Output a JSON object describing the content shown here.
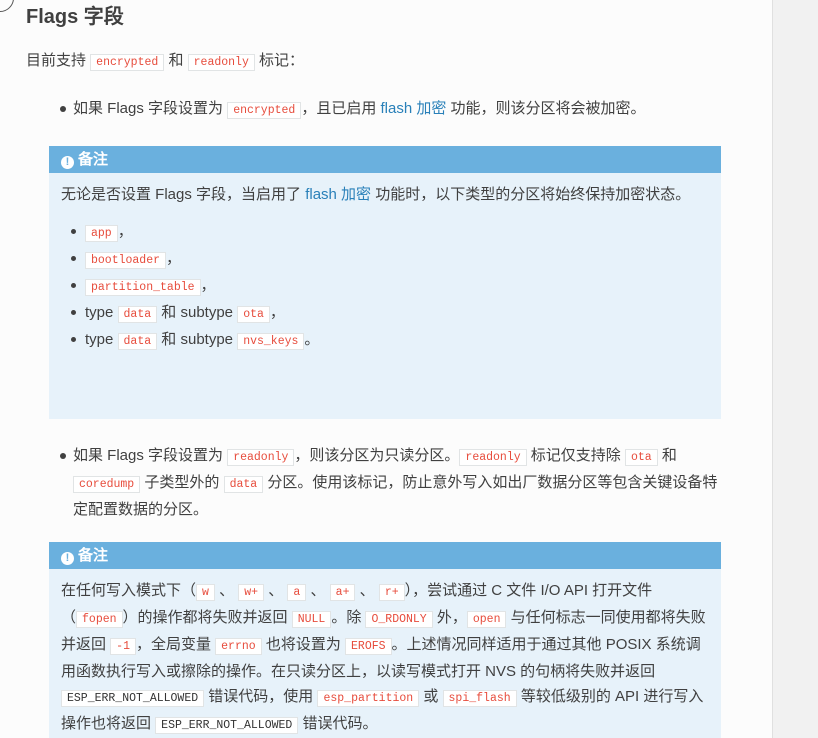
{
  "heading": "Flags 字段",
  "intro": {
    "pre": "目前支持 ",
    "code1": "encrypted",
    "mid": " 和 ",
    "code2": "readonly",
    "post": " 标记："
  },
  "item1": {
    "pre": "如果 Flags 字段设置为 ",
    "code": "encrypted",
    "mid": "，且已启用 ",
    "link": "flash 加密",
    "post": " 功能，则该分区将会被加密。"
  },
  "note1": {
    "title": "备注",
    "text_pre": "无论是否设置 Flags 字段，当启用了 ",
    "link": "flash 加密",
    "text_post": " 功能时，以下类型的分区将始终保持加密状态。",
    "items": [
      {
        "code": "app",
        "suffix": "，"
      },
      {
        "code": "bootloader",
        "suffix": "，"
      },
      {
        "code": "partition_table",
        "suffix": "，"
      },
      {
        "pre": "type ",
        "code": "data",
        "mid": " 和 subtype ",
        "code2": "ota",
        "suffix": "，"
      },
      {
        "pre": "type ",
        "code": "data",
        "mid": " 和 subtype ",
        "code2": "nvs_keys",
        "suffix": "。"
      }
    ]
  },
  "item2": {
    "t1": "如果 Flags 字段设置为 ",
    "c1": "readonly",
    "t2": "，则该分区为只读分区。",
    "c2": "readonly",
    "t3": " 标记仅支持除 ",
    "c3": "ota",
    "t4": " 和 ",
    "c4": "coredump",
    "t5": " 子类型外的 ",
    "c5": "data",
    "t6": " 分区。使用该标记，防止意外写入如出厂数据分区等包含关键设备特定配置数据的分区。"
  },
  "note2": {
    "title": "备注",
    "t1": "在任何写入模式下（",
    "c1": "w",
    "s1": " 、 ",
    "c2": "w+",
    "s2": " 、 ",
    "c3": "a",
    "s3": " 、 ",
    "c4": "a+",
    "s4": " 、 ",
    "c5": "r+",
    "t2": "），尝试通过 C 文件 I/O API 打开文件（",
    "c6": "fopen",
    "t3": "）的操作都将失败并返回 ",
    "c7": "NULL",
    "t4": "。除 ",
    "c8": "O_RDONLY",
    "t5": " 外，",
    "c9": "open",
    "t6": " 与任何标志一同使用都将失败并返回 ",
    "c10": "-1",
    "t7": "，全局变量 ",
    "c11": "errno",
    "t8": " 也将设置为 ",
    "c12": "EROFS",
    "t9": "。上述情况同样适用于通过其他 POSIX 系统调用函数执行写入或擦除的操作。在只读分区上，以读写模式打开 NVS 的句柄将失败并返回 ",
    "c13": "ESP_ERR_NOT_ALLOWED",
    "t10": " 错误代码，使用 ",
    "c14": "esp_partition",
    "t11": " 或 ",
    "c15": "spi_flash",
    "t12": " 等较低级别的 API 进行写入操作也将返回 ",
    "c16": "ESP_ERR_NOT_ALLOWED",
    "t13": " 错误代码。"
  }
}
